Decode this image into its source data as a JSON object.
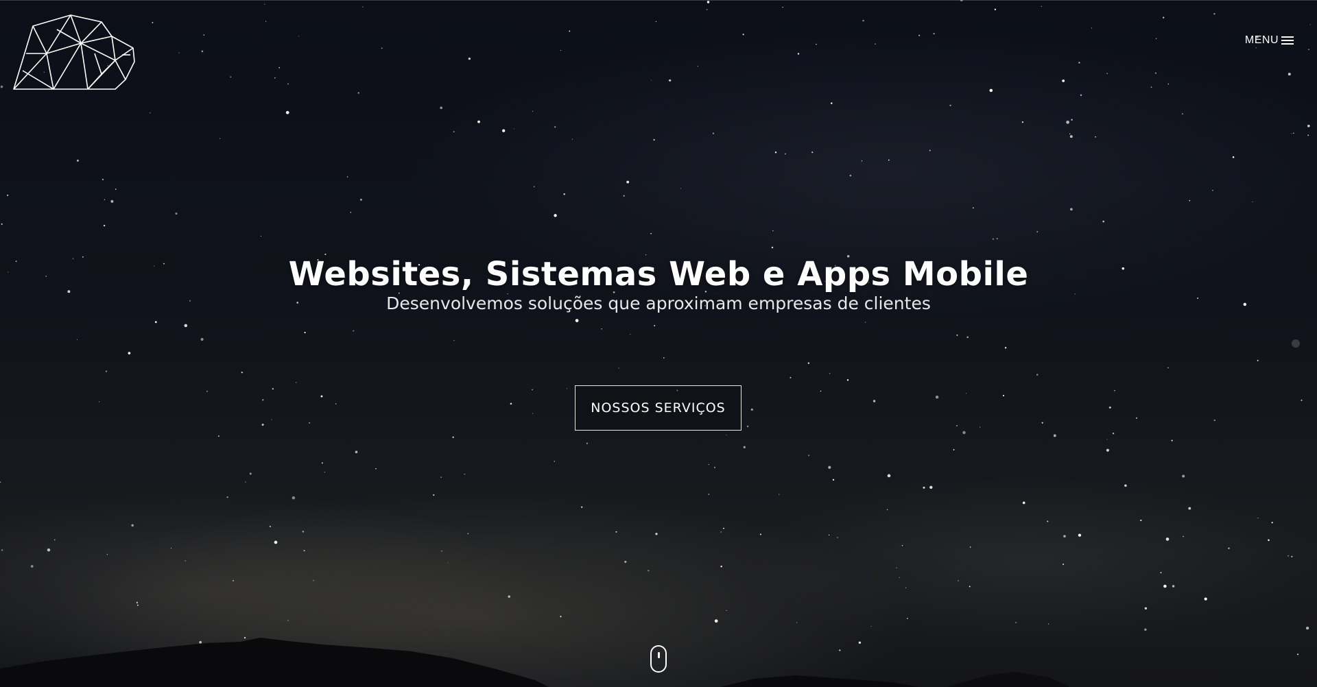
{
  "header": {
    "logo_icon": "lion-geometric-logo-icon",
    "menu_label": "MENU",
    "menu_icon": "hamburger-icon"
  },
  "hero": {
    "title": "Websites, Sistemas Web e Apps Mobile",
    "subtitle": "Desenvolvemos soluções que aproximam empresas de clientes",
    "cta_label": "NOSSOS SERVIÇOS",
    "scroll_icon": "mouse-scroll-icon",
    "side_nav_icon": "dot-indicator-icon"
  },
  "colors": {
    "text": "#ffffff",
    "background": "#0d0f16",
    "button_border": "#e5e5e5"
  }
}
